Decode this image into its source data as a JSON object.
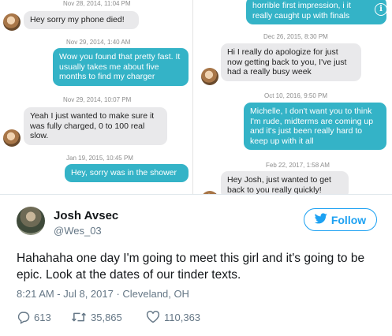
{
  "left_panel": {
    "stamp_top": "Nov 28, 2014, 11:04 PM",
    "messages": [
      {
        "dir": "in",
        "text": "Hey sorry my phone died!"
      },
      {
        "dir": "stamp",
        "text": "Nov 29, 2014, 1:40 AM"
      },
      {
        "dir": "out",
        "text": "Wow you found that pretty fast. It usually takes me about  five months to find my charger"
      },
      {
        "dir": "stamp",
        "text": "Nov 29, 2014, 10:07 PM"
      },
      {
        "dir": "in",
        "text": "Yeah I just wanted to make sure it was fully charged, 0 to 100 real slow."
      },
      {
        "dir": "stamp",
        "text": "Jan 19, 2015, 10:45 PM"
      },
      {
        "dir": "out",
        "text": "Hey, sorry was in the shower"
      }
    ]
  },
  "right_panel": {
    "messages": [
      {
        "dir": "out",
        "text": "horrible first impression, i it really caught up with finals"
      },
      {
        "dir": "stamp",
        "text": "Dec 26, 2015, 8:30 PM"
      },
      {
        "dir": "in",
        "text": "Hi I really do apologize for just now getting back to you, I've just had a really busy week"
      },
      {
        "dir": "stamp",
        "text": "Oct 10, 2016, 9:50 PM"
      },
      {
        "dir": "out",
        "text": "Michelle, I don't want you to think I'm rude, midterms are coming up and it's just been really hard to keep up with it all"
      },
      {
        "dir": "stamp",
        "text": "Feb 22, 2017, 1:58 AM"
      },
      {
        "dir": "in",
        "text": "Hey Josh, just wanted to get back to you really quickly!"
      }
    ],
    "info_icon": "info-icon"
  },
  "tweet": {
    "name": "Josh Avsec",
    "handle": "@Wes_03",
    "follow_label": "Follow",
    "text": "Hahahaha one day I'm going to meet this girl and it's going to be epic. Look at the dates of our tinder texts.",
    "meta": "8:21 AM - Jul 8, 2017 · Cleveland, OH",
    "replies": "613",
    "retweets": "35,865",
    "likes": "110,363",
    "accent": "#1da1f2",
    "bubble_color": "#34b3c7"
  }
}
